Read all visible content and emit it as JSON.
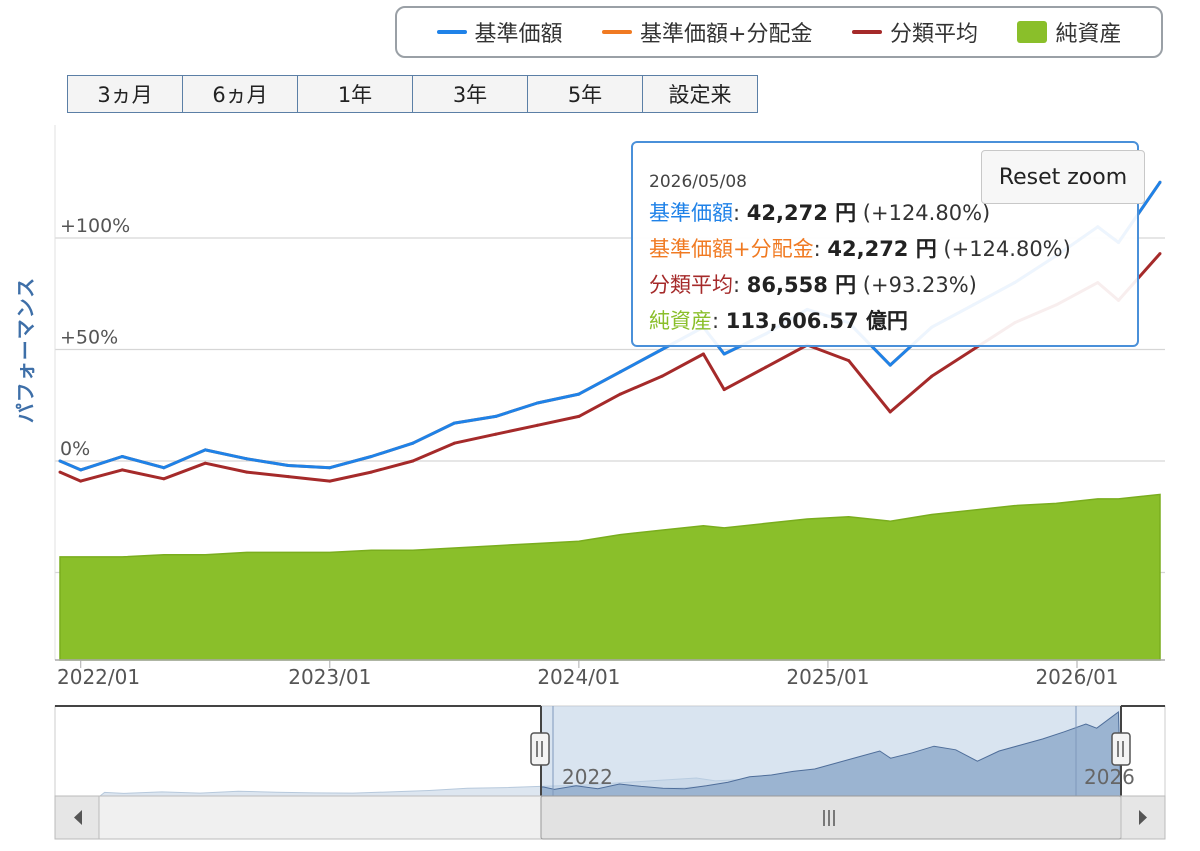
{
  "legend": {
    "items": [
      {
        "label": "基準価額",
        "color": "#1f82e8",
        "kind": "line"
      },
      {
        "label": "基準価額+分配金",
        "color": "#f07a22",
        "kind": "line"
      },
      {
        "label": "分類平均",
        "color": "#a52a2a",
        "kind": "line"
      },
      {
        "label": "純資産",
        "color": "#8abf2a",
        "kind": "box"
      }
    ]
  },
  "range_buttons": [
    "3ヵ月",
    "6ヵ月",
    "1年",
    "3年",
    "5年",
    "設定来"
  ],
  "tooltip": {
    "date": "2026/05/08",
    "rows": [
      {
        "name": "基準価額",
        "value": "42,272 円",
        "change": "(+124.80%)",
        "color": "#1f82e8"
      },
      {
        "name": "基準価額+分配金",
        "value": "42,272 円",
        "change": "(+124.80%)",
        "color": "#f07a22"
      },
      {
        "name": "分類平均",
        "value": "86,558 円",
        "change": "(+93.23%)",
        "color": "#a52a2a"
      },
      {
        "name": "純資産",
        "value": "113,606.57 億円",
        "change": "",
        "color": "#8abf2a"
      }
    ]
  },
  "reset_zoom_label": "Reset zoom",
  "navigator": {
    "start_label": "2022",
    "end_label": "2026"
  },
  "chart_data": {
    "type": "line",
    "ylabel": "パフォーマンス",
    "ylim": [
      -50,
      125
    ],
    "y_ticks": [
      "0%",
      "+50%",
      "+100%"
    ],
    "x_tick_labels": [
      "2022/01",
      "2023/01",
      "2024/01",
      "2025/01",
      "2026/01"
    ],
    "x": [
      "2021/12",
      "2022/01",
      "2022/03",
      "2022/05",
      "2022/07",
      "2022/09",
      "2022/11",
      "2023/01",
      "2023/03",
      "2023/05",
      "2023/07",
      "2023/09",
      "2023/11",
      "2024/01",
      "2024/03",
      "2024/05",
      "2024/07",
      "2024/08",
      "2024/10",
      "2024/12",
      "2025/02",
      "2025/04",
      "2025/06",
      "2025/08",
      "2025/10",
      "2025/12",
      "2026/02",
      "2026/03",
      "2026/05"
    ],
    "series": [
      {
        "name": "基準価額",
        "color": "#1f82e8",
        "values": [
          0,
          -4,
          2,
          -3,
          5,
          1,
          -2,
          -3,
          2,
          8,
          17,
          20,
          26,
          30,
          40,
          50,
          60,
          48,
          57,
          68,
          62,
          43,
          60,
          70,
          80,
          92,
          105,
          98,
          125
        ]
      },
      {
        "name": "基準価額+分配金",
        "color": "#f07a22",
        "values": [
          0,
          -4,
          2,
          -3,
          5,
          1,
          -2,
          -3,
          2,
          8,
          17,
          20,
          26,
          30,
          40,
          50,
          60,
          48,
          57,
          68,
          62,
          43,
          60,
          70,
          80,
          92,
          105,
          98,
          125
        ]
      },
      {
        "name": "分類平均",
        "color": "#a52a2a",
        "values": [
          -5,
          -9,
          -4,
          -8,
          -1,
          -5,
          -7,
          -9,
          -5,
          0,
          8,
          12,
          16,
          20,
          30,
          38,
          48,
          32,
          42,
          52,
          45,
          22,
          38,
          50,
          62,
          70,
          80,
          72,
          93
        ]
      },
      {
        "name": "純資産",
        "color": "#8abf2a",
        "type": "area",
        "values": [
          -43,
          -43,
          -43,
          -42,
          -42,
          -41,
          -41,
          -41,
          -40,
          -40,
          -39,
          -38,
          -37,
          -36,
          -33,
          -31,
          -29,
          -30,
          -28,
          -26,
          -25,
          -27,
          -24,
          -22,
          -20,
          -19,
          -17,
          -17,
          -15
        ]
      }
    ]
  }
}
